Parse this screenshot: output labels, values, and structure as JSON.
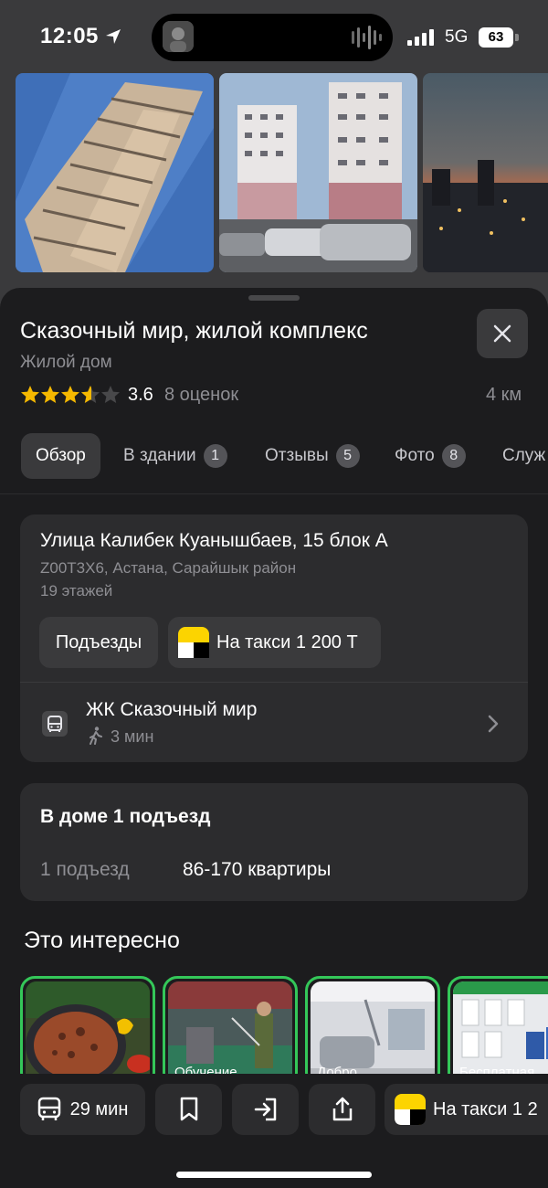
{
  "status_bar": {
    "time": "12:05",
    "network": "5G",
    "battery": "63"
  },
  "place": {
    "title": "Сказочный мир, жилой комплекс",
    "subtitle": "Жилой дом",
    "rating": "3.6",
    "rating_stars": 3.6,
    "ratings_count": "8 оценок",
    "distance": "4 км"
  },
  "tabs": [
    {
      "label": "Обзор",
      "badge": null
    },
    {
      "label": "В здании",
      "badge": "1"
    },
    {
      "label": "Отзывы",
      "badge": "5"
    },
    {
      "label": "Фото",
      "badge": "8"
    },
    {
      "label": "Служ",
      "badge": null
    }
  ],
  "address": {
    "line": "Улица Калибек Куанышбаев, 15 блок А",
    "sub": "Z00T3X6, Астана, Сарайшык район",
    "floors": "19 этажей",
    "entrances_chip": "Подъезды",
    "taxi_chip": "На такси 1 200 Т"
  },
  "transit": {
    "stop": "ЖК Сказочный мир",
    "walk": "3 мин"
  },
  "entrances": {
    "title": "В доме 1 подъезд",
    "count": "1 подъезд",
    "apartments": "86-170 квартиры"
  },
  "interesting": {
    "title": "Это интересно",
    "stories": [
      "",
      "Обучение",
      "Добро",
      "Бесплатная"
    ]
  },
  "bottom_bar": {
    "route": "29 мин",
    "taxi": "На такси 1 2"
  },
  "colors": {
    "accent_green": "#34c759",
    "sheet": "#1c1c1e",
    "card": "#2c2c2e",
    "star": "#f5b800",
    "taxi_yellow": "#fcd400"
  }
}
